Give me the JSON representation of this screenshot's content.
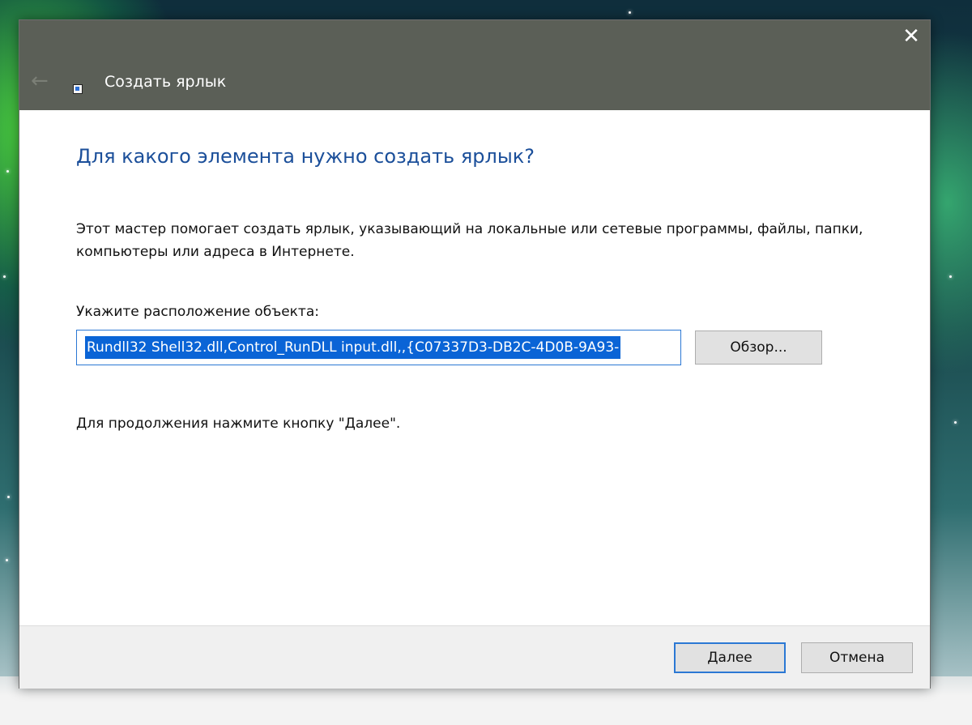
{
  "window": {
    "title": "Создать ярлык",
    "close_glyph": "✕",
    "back_glyph": "←"
  },
  "content": {
    "heading": "Для какого элемента нужно создать ярлык?",
    "description": "Этот мастер помогает создать ярлык, указывающий на локальные или сетевые программы, файлы, папки, компьютеры или адреса в Интернете.",
    "location_label": "Укажите расположение объекта:",
    "location_value": "Rundll32 Shell32.dll,Control_RunDLL input.dll,,{C07337D3-DB2C-4D0B-9A93-",
    "browse_label": "Обзор...",
    "continue_hint": "Для продолжения нажмите кнопку \"Далее\"."
  },
  "footer": {
    "next_label": "Далее",
    "cancel_label": "Отмена"
  },
  "icons": {
    "back": "back-arrow-icon",
    "window": "shortcut-wizard-icon",
    "close": "close-icon"
  },
  "colors": {
    "titlebar": "#5b5f57",
    "heading": "#1b4f9a",
    "selection": "#0a64d6",
    "focus_border": "#2b78d4"
  }
}
